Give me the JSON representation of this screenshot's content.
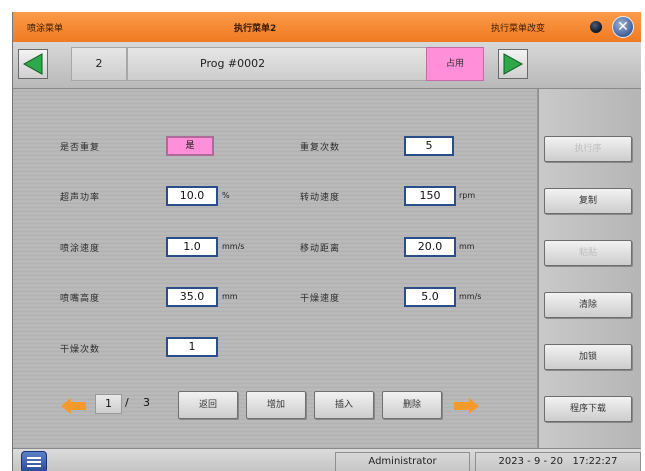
{
  "titlebar": {
    "left_title": "喷涂菜单",
    "center_title": "执行菜单2",
    "right_title": "执行菜单改变",
    "close_icon": "close-icon"
  },
  "nav": {
    "program_number": "2",
    "program_name": "Prog #0002",
    "status": "占用",
    "prev_icon": "left-arrow-icon",
    "next_icon": "right-arrow-icon"
  },
  "params": {
    "repeat": {
      "label": "是否重复",
      "value": "是"
    },
    "repeat_count": {
      "label": "重复次数",
      "value": "5"
    },
    "ultrasonic_power": {
      "label": "超声功率",
      "value": "10.0",
      "unit": "%"
    },
    "rotation_speed": {
      "label": "转动速度",
      "value": "150",
      "unit": "rpm"
    },
    "spray_speed": {
      "label": "喷涂速度",
      "value": "1.0",
      "unit": "mm/s"
    },
    "move_distance": {
      "label": "移动距离",
      "value": "20.0",
      "unit": "mm"
    },
    "nozzle_height": {
      "label": "喷嘴高度",
      "value": "35.0",
      "unit": "mm"
    },
    "dry_speed": {
      "label": "干燥速度",
      "value": "5.0",
      "unit": "mm/s"
    },
    "dry_count": {
      "label": "干燥次数",
      "value": "1"
    }
  },
  "sidebar": {
    "buttons": [
      {
        "label": "执行序",
        "enabled": false
      },
      {
        "label": "复制",
        "enabled": true
      },
      {
        "label": "粘贴",
        "enabled": false
      },
      {
        "label": "清除",
        "enabled": true
      },
      {
        "label": "加锁",
        "enabled": true
      },
      {
        "label": "程序下载",
        "enabled": true
      }
    ]
  },
  "pagination": {
    "current": "1",
    "separator": "/",
    "total": "3"
  },
  "actions": {
    "back": "返回",
    "add": "增加",
    "insert": "插入",
    "delete": "删除"
  },
  "status": {
    "user": "Administrator",
    "datetime": "2023 - 9 - 20   17:22:27"
  },
  "colors": {
    "title_orange": "#f07a22",
    "field_border": "#2b4d8a",
    "pink": "#ff8fd8",
    "arrow_green": "#2fa84a",
    "page_arrow_orange": "#f59a2a"
  }
}
